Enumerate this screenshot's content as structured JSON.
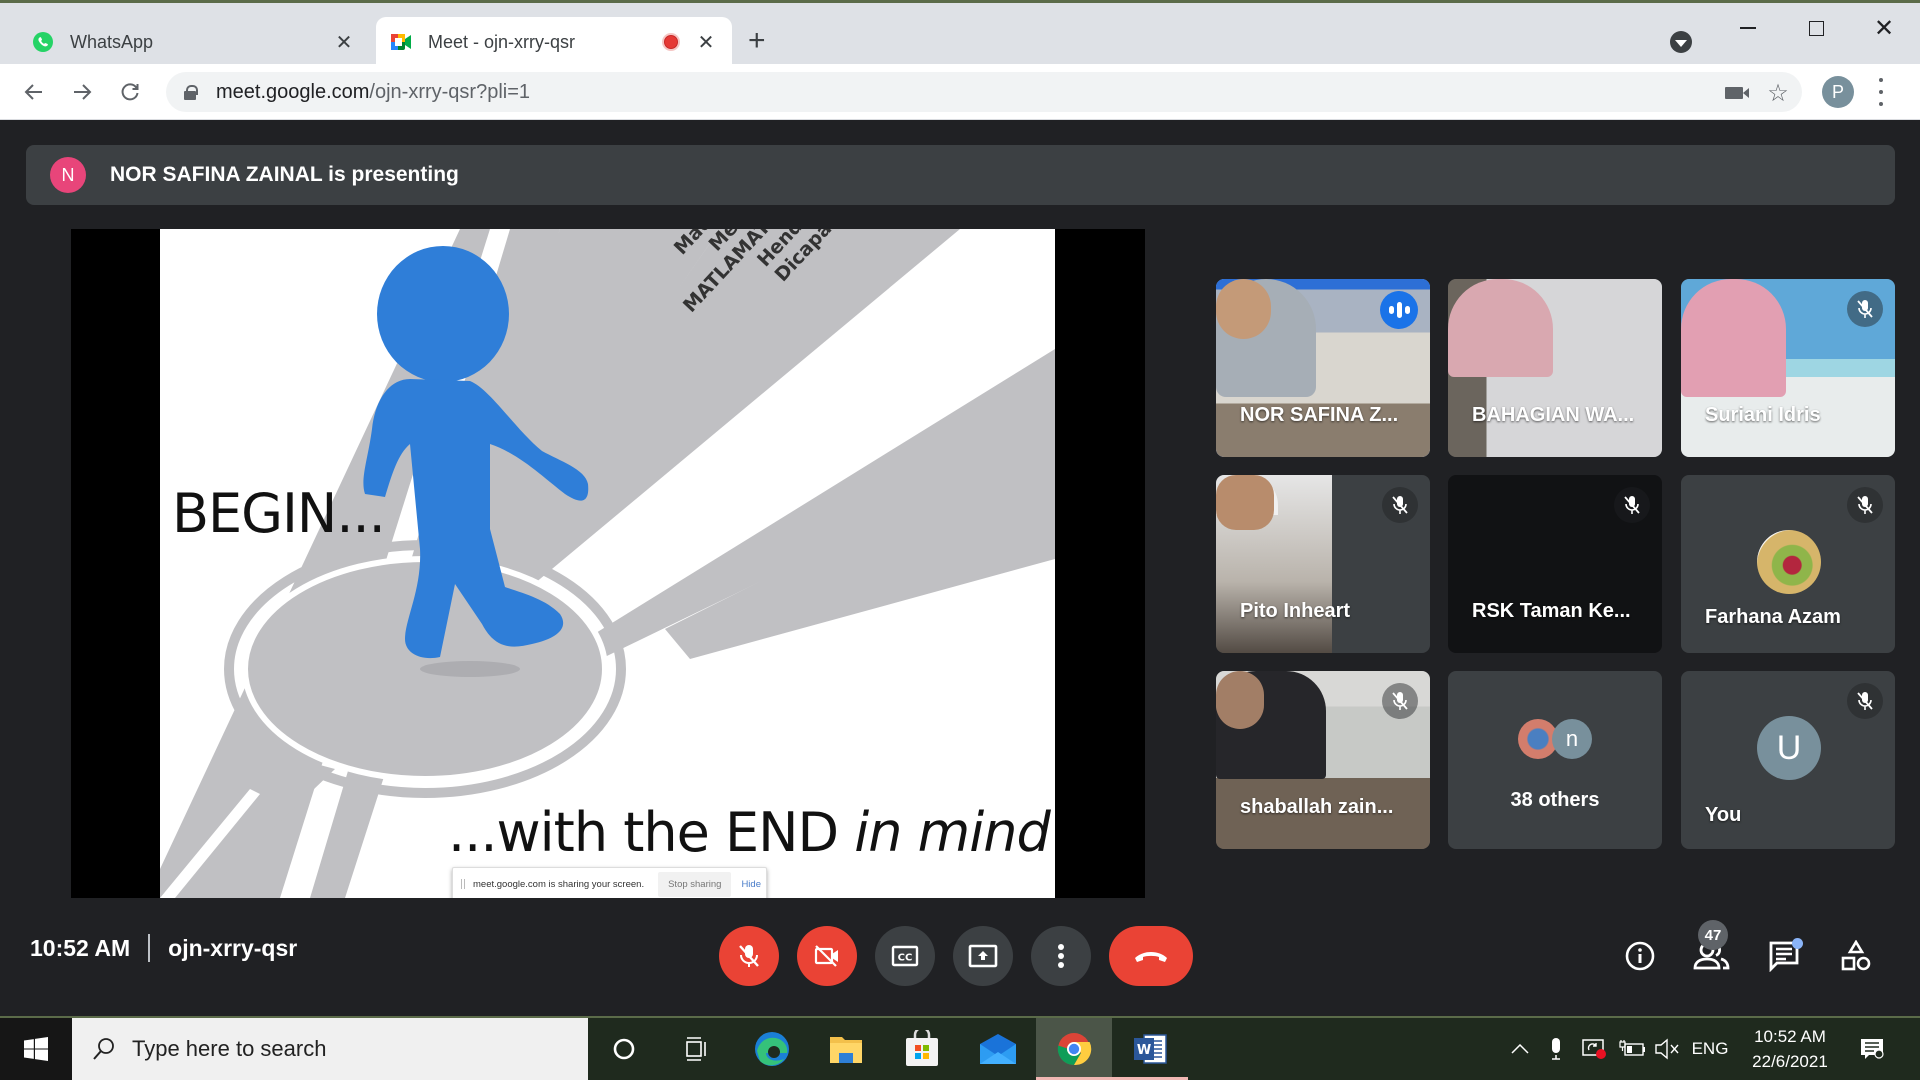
{
  "browser": {
    "tabs": [
      {
        "title": "WhatsApp",
        "icon": "whatsapp-icon",
        "active": false
      },
      {
        "title": "Meet - ojn-xrry-qsr",
        "icon": "google-meet-icon",
        "active": true,
        "recording": true
      }
    ],
    "url": {
      "host": "meet.google.com",
      "path": "/ojn-xrry-qsr?pli=1"
    },
    "profile_initial": "P"
  },
  "meet": {
    "presenter_banner": {
      "initial": "N",
      "text": "NOR SAFINA ZAINAL is presenting",
      "avatar_color": "#e8457a"
    },
    "slide": {
      "begin_text": "BEGIN...",
      "road_text_lines": [
        "Maqasid Syariah Meletakkan",
        "MATLAMAT AKHIR Yang Hendak",
        "Dicapai"
      ],
      "end_text_plain": "...with the END ",
      "end_text_italic": "in mind",
      "end_text_suffix": "!"
    },
    "share_notice": {
      "message": "meet.google.com is sharing your screen.",
      "stop_label": "Stop sharing",
      "hide_label": "Hide"
    },
    "participants": [
      {
        "name": "NOR SAFINA Z...",
        "speaking": true,
        "muted": false,
        "type": "video"
      },
      {
        "name": "BAHAGIAN WA...",
        "speaking": false,
        "muted": false,
        "type": "video"
      },
      {
        "name": "Suriani Idris",
        "speaking": false,
        "muted": true,
        "type": "video"
      },
      {
        "name": "Pito Inheart",
        "speaking": false,
        "muted": true,
        "type": "video"
      },
      {
        "name": "RSK Taman Ke...",
        "speaking": false,
        "muted": true,
        "type": "video-off"
      },
      {
        "name": "Farhana Azam",
        "speaking": false,
        "muted": true,
        "type": "photo-avatar"
      },
      {
        "name": "shaballah zain...",
        "speaking": false,
        "muted": true,
        "type": "video"
      },
      {
        "name": "38 others",
        "speaking": false,
        "muted": false,
        "type": "others",
        "avatar_initial": "n"
      },
      {
        "name": "You",
        "speaking": false,
        "muted": true,
        "type": "avatar",
        "avatar_initial": "U"
      }
    ],
    "bottom_bar": {
      "time": "10:52 AM",
      "meeting_code": "ojn-xrry-qsr",
      "controls": [
        "microphone-off",
        "camera-off",
        "captions",
        "present-now",
        "more-options",
        "leave-call"
      ],
      "people_count": "47",
      "chat_has_unread": true
    },
    "colors": {
      "danger": "#ea4335",
      "accent": "#8ab4f8",
      "surface": "#3c4043",
      "background": "#202124"
    }
  },
  "taskbar": {
    "search_placeholder": "Type here to search",
    "apps": [
      "cortana",
      "task-view",
      "edge",
      "file-explorer",
      "microsoft-store",
      "mail",
      "chrome",
      "word"
    ],
    "active_app": "chrome",
    "language": "ENG",
    "time": "10:52 AM",
    "date": "22/6/2021"
  }
}
